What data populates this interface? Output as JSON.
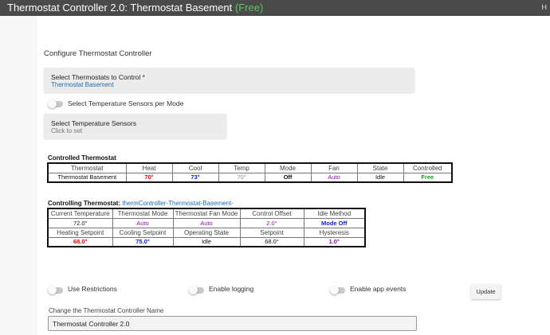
{
  "header": {
    "title": "Thermostat Controller 2.0: Thermostat Basement",
    "free_tag": "(Free)",
    "menu_glyph": "H"
  },
  "page": {
    "section_title": "Configure Thermostat Controller"
  },
  "select_thermostats": {
    "label": "Select Thermostats to Control *",
    "value": "Thermostat Basement"
  },
  "sensors_per_mode": {
    "label": "Select Temperature Sensors per Mode",
    "enabled": false
  },
  "select_sensors": {
    "label": "Select Temperature Sensors",
    "placeholder": "Click to set"
  },
  "controlled_table": {
    "heading": "Controlled Thermostat",
    "headers": [
      "Thermostat",
      "Heat",
      "Cool",
      "Temp",
      "Mode",
      "Fan",
      "State",
      "Controlled"
    ],
    "row": [
      "Thermostat Basement",
      "70°",
      "73°",
      "70°",
      "Off",
      "Auto",
      "Idle",
      "Free"
    ]
  },
  "controlling_table": {
    "heading": "Controlling Thermostat:",
    "link": "thermController-Thermostat-Basement-",
    "headers1": [
      "Current Temperature",
      "Thermostat Mode",
      "Thermostat Fan Mode",
      "Control Offset",
      "Idle Method"
    ],
    "values1": [
      "72.0°",
      "Auto",
      "Auto",
      "2.0°",
      "Mode Off"
    ],
    "headers2": [
      "Heating Setpoint",
      "Cooling Setpoint",
      "Operating State",
      "Setpoint",
      "Hysteresis"
    ],
    "values2": [
      "68.0°",
      "75.0°",
      "Idle",
      "68.0°",
      "1.0°"
    ]
  },
  "options": {
    "use_restrictions": "Use Restrictions",
    "enable_logging": "Enable logging",
    "enable_app_events": "Enable app events",
    "update_button": "Update"
  },
  "name_field": {
    "label": "Change the Thermostat Controller Name",
    "value": "Thermostat Controller 2.0"
  },
  "colors": {
    "red": "#e00000",
    "blue": "#1020c8",
    "purple": "#8a10a8",
    "green": "#1f9a1f",
    "gray": "#888888",
    "link": "#1a6fb8"
  }
}
